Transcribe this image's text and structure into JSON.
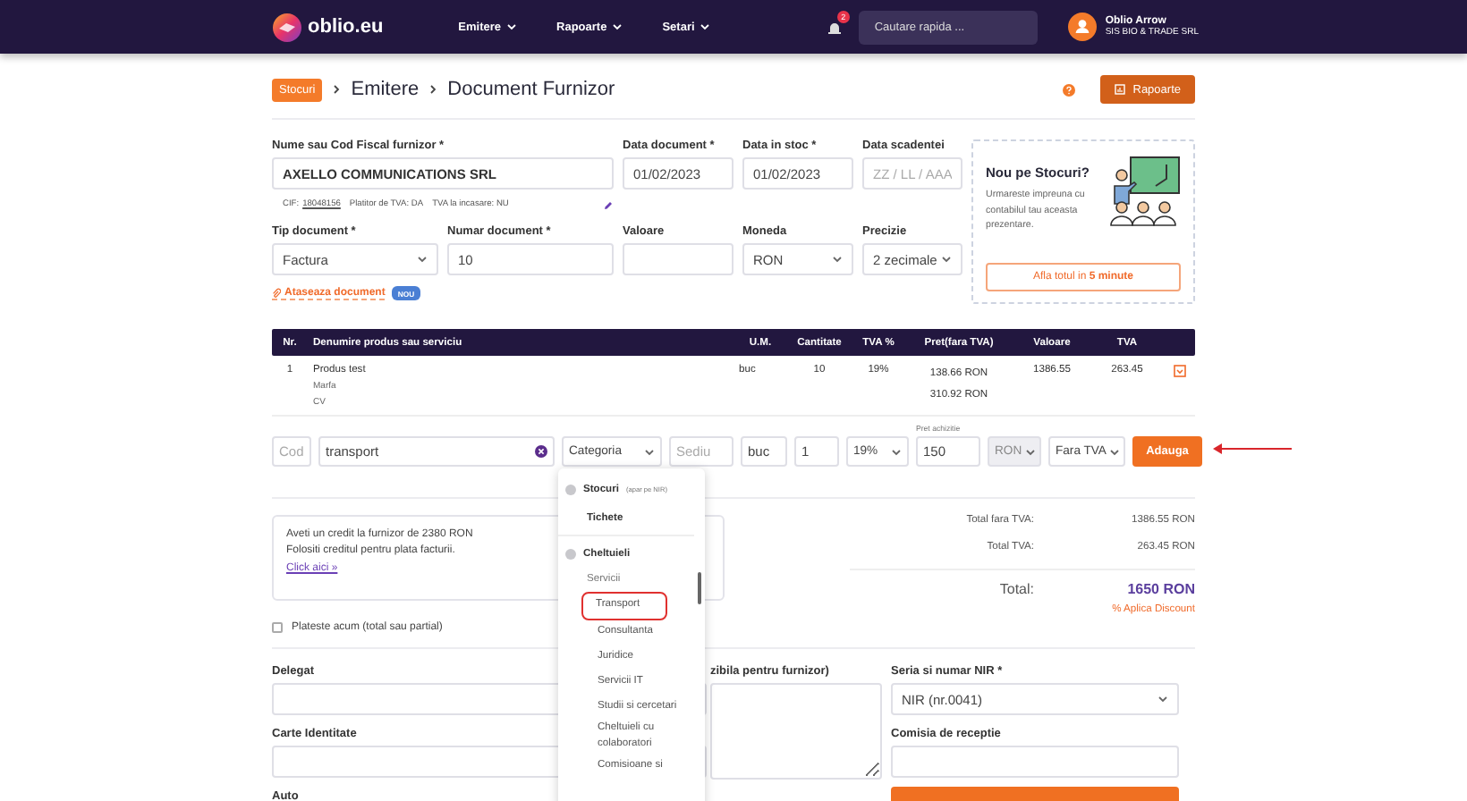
{
  "header": {
    "logo": "oblio.eu",
    "menu": [
      {
        "label": "Emitere"
      },
      {
        "label": "Rapoarte"
      },
      {
        "label": "Setari"
      }
    ],
    "notification_count": "2",
    "search": {
      "placeholder": "Cautare rapida ..."
    },
    "user": {
      "name": "Oblio Arrow",
      "company": "SIS BIO & TRADE SRL"
    }
  },
  "breadcrumb": [
    {
      "label": "Stocuri",
      "kind": "badge"
    },
    {
      "label": "Emitere",
      "kind": "text"
    },
    {
      "label": "Document Furnizor",
      "kind": "text"
    }
  ],
  "reports_button": "Rapoarte",
  "supplier": {
    "label": "Nume sau Cod Fiscal furnizor *",
    "value": "AXELLO COMMUNICATIONS SRL",
    "cif_label": "CIF:",
    "cif": "18048156",
    "vat_payer": "Platitor de TVA: DA",
    "vat_on_collection": "TVA la incasare: NU"
  },
  "dates": [
    {
      "label": "Data document *",
      "value": "01/02/2023"
    },
    {
      "label": "Data in stoc *",
      "value": "01/02/2023"
    },
    {
      "label": "Data scadentei",
      "placeholder": "ZZ / LL / AAA"
    }
  ],
  "document_fields": [
    {
      "label": "Tip document *",
      "kind": "select",
      "value": "Factura"
    },
    {
      "label": "Numar document *",
      "kind": "input",
      "value": "10"
    },
    {
      "label": "Valoare",
      "kind": "input"
    },
    {
      "label": "Moneda",
      "kind": "select",
      "value": "RON"
    },
    {
      "label": "Precizie",
      "kind": "select",
      "value": "2 zecimale"
    }
  ],
  "attach": {
    "label": "Ataseaza document",
    "badge": "NOU"
  },
  "promo": {
    "title": "Nou pe Stocuri?",
    "text": "Urmareste impreuna cu contabilul tau aceasta prezentare.",
    "button": "Afla totul in **5 minute**"
  },
  "table": {
    "columns": [
      "Nr.",
      "Denumire produs sau serviciu",
      "U.M.",
      "Cantitate",
      "TVA %",
      "Pret(fara TVA)",
      "Valoare",
      "TVA"
    ],
    "rows": [
      {
        "nr": "1",
        "name": "Produs test",
        "details": [
          "Marfa",
          "CV"
        ],
        "um": "buc",
        "quantity": "10",
        "vat_rate": "19%",
        "prices": [
          "138.66 RON",
          "310.92 RON"
        ],
        "value": "1386.55",
        "vat": "263.45"
      }
    ]
  },
  "entry": [
    {
      "kind": "input",
      "placeholder": "Cod",
      "disabled": false
    },
    {
      "kind": "search",
      "value": "transport",
      "disabled": false
    },
    {
      "kind": "select",
      "value": "Categoria",
      "disabled": false
    },
    {
      "kind": "input",
      "placeholder": "Sediu",
      "disabled": false
    },
    {
      "kind": "input",
      "value": "buc",
      "disabled": false
    },
    {
      "kind": "input",
      "value": "1",
      "disabled": false
    },
    {
      "kind": "select",
      "value": "19%",
      "disabled": false
    },
    {
      "kind": "input",
      "label": "Pret achizitie",
      "value": "150",
      "disabled": false
    },
    {
      "kind": "select",
      "value": "RON",
      "disabled": true
    },
    {
      "kind": "select",
      "value": "Fara TVA",
      "disabled": false
    },
    {
      "kind": "button",
      "label": "Adauga",
      "disabled": false
    }
  ],
  "dropdown": [
    {
      "kind": "group",
      "label": "Stocuri",
      "note": "(apar pe NIR)"
    },
    {
      "kind": "heading",
      "label": "Tichete"
    },
    {
      "kind": "group",
      "label": "Cheltuieli"
    },
    {
      "kind": "subheading",
      "label": "Servicii"
    },
    {
      "kind": "option",
      "label": "Transport",
      "selected": true
    },
    {
      "kind": "option",
      "label": "Consultanta",
      "selected": false
    },
    {
      "kind": "option",
      "label": "Juridice",
      "selected": false
    },
    {
      "kind": "option",
      "label": "Servicii IT",
      "selected": false
    },
    {
      "kind": "option",
      "label": "Studii si cercetari",
      "selected": false
    },
    {
      "kind": "option",
      "label": "Cheltuieli cu colaboratori",
      "selected": false
    },
    {
      "kind": "option",
      "label": "Comisioane si",
      "selected": false
    }
  ],
  "credit": {
    "lines": [
      "Aveti un credit la furnizor de 2380 RON",
      "Folositi creditul pentru plata facturii."
    ],
    "link": "Click aici »"
  },
  "pay_now": {
    "label": "Plateste acum (total sau partial)",
    "checked": false
  },
  "totals": [
    {
      "label": "Total fara TVA:",
      "value": "1386.55 RON"
    },
    {
      "label": "Total TVA:",
      "value": "263.45 RON"
    }
  ],
  "grand_total": {
    "label": "Total:",
    "value": "1650 RON"
  },
  "discount": "% Aplica Discount",
  "delivery_fields": [
    {
      "label": "Delegat"
    },
    {
      "label": "Carte Identitate"
    },
    {
      "label": "Auto"
    }
  ],
  "notes_label": "zibila pentru furnizor)",
  "nir": {
    "label": "Seria si numar NIR *",
    "value": "NIR (nr.0041)"
  },
  "commission": {
    "label": "Comisia de receptie"
  }
}
